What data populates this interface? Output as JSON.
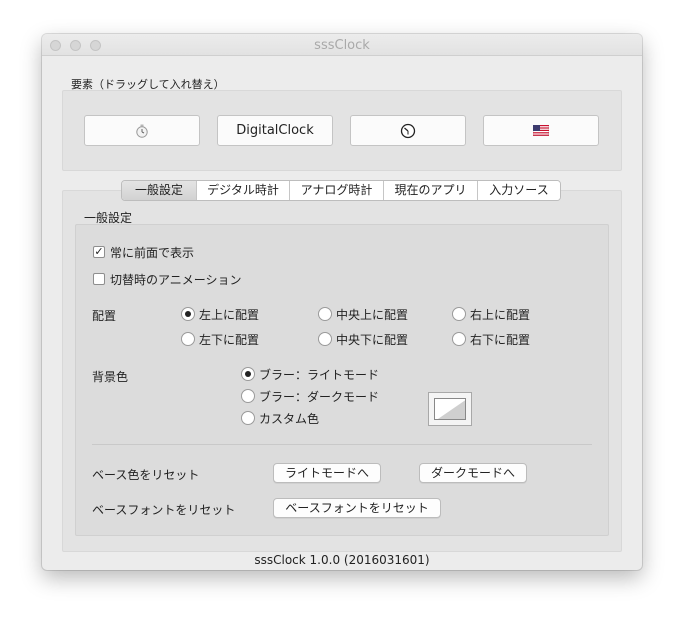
{
  "window": {
    "title": "sssClock"
  },
  "elements_section": {
    "label": "要素（ドラッグして入れ替え）",
    "items": [
      {
        "icon": "clock-app-icon"
      },
      {
        "label": "DigitalClock"
      },
      {
        "icon": "analog-clock-icon"
      },
      {
        "icon": "us-flag-icon"
      }
    ]
  },
  "tabs": [
    {
      "label": "一般設定",
      "selected": true
    },
    {
      "label": "デジタル時計"
    },
    {
      "label": "アナログ時計"
    },
    {
      "label": "現在のアプリ"
    },
    {
      "label": "入力ソース"
    }
  ],
  "general": {
    "group_label": "一般設定",
    "always_on_top": {
      "label": "常に前面で表示",
      "checked": true
    },
    "switch_animation": {
      "label": "切替時のアニメーション",
      "checked": false
    },
    "placement": {
      "label": "配置",
      "options": [
        "左上に配置",
        "中央上に配置",
        "右上に配置",
        "左下に配置",
        "中央下に配置",
        "右下に配置"
      ],
      "selected": "左上に配置"
    },
    "background": {
      "label": "背景色",
      "options": [
        "ブラー：ライトモード",
        "ブラー：ダークモード",
        "カスタム色"
      ],
      "selected": "ブラー：ライトモード"
    },
    "reset_base_color": {
      "label": "ベース色をリセット",
      "light_button": "ライトモードへ",
      "dark_button": "ダークモードへ"
    },
    "reset_base_font": {
      "label": "ベースフォントをリセット",
      "button": "ベースフォントをリセット"
    }
  },
  "footer": {
    "version": "sssClock 1.0.0 (2016031601)"
  },
  "colors": {
    "window_bg": "#ececec",
    "panel_bg": "#e3e3e3",
    "selected_tab": "#d8d8d8"
  }
}
